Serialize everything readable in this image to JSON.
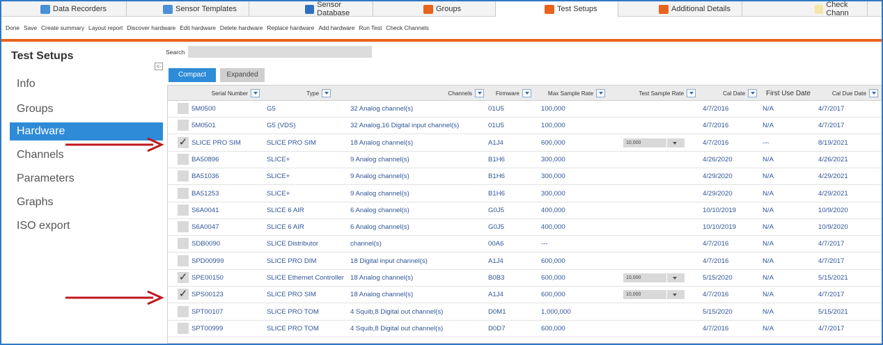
{
  "tabs": [
    {
      "label": "Data Recorders",
      "icon": "data-recorders-icon",
      "color": "#4a90d9"
    },
    {
      "label": "Sensor Templates",
      "icon": "sensor-templates-icon",
      "color": "#4a90d9"
    },
    {
      "label": "Sensor Database",
      "icon": "sensor-database-icon",
      "color": "#2e6fc0"
    },
    {
      "label": "Groups",
      "icon": "groups-icon",
      "color": "#e8641b"
    },
    {
      "label": "Test Setups",
      "icon": "test-setups-icon",
      "color": "#e8641b",
      "active": true
    },
    {
      "label": "Additional Details",
      "icon": "additional-details-icon",
      "color": "#e8641b"
    },
    {
      "label": "Check Chann",
      "icon": "check-channels-icon",
      "color": "#f5e6a6"
    }
  ],
  "toolbar": [
    "Done",
    "Save",
    "Create summary",
    "Layout report",
    "Discover hardware",
    "Edit hardware",
    "Delete hardware",
    "Replace hardware",
    "Add hardware",
    "Run Test",
    "Check Channels"
  ],
  "sidebar": {
    "title": "Test Setups",
    "collapse": "<-",
    "items": [
      "Info",
      "Groups",
      "Hardware",
      "Channels",
      "Parameters",
      "Graphs",
      "ISO export"
    ],
    "active": "Hardware"
  },
  "search": {
    "label": "Search",
    "value": ""
  },
  "view": {
    "compact": "Compact",
    "expanded": "Expanded"
  },
  "grid": {
    "columns": [
      "Serial Number",
      "Type",
      "Channels",
      "Firmware",
      "Max Sample Rate",
      "Test Sample Rate",
      "Cal Date",
      "First Use Date",
      "Cal Due Date"
    ],
    "rows": [
      {
        "checked": "",
        "serial": "5M0500",
        "type": "G5",
        "channels": "32 Analog channel(s)",
        "firmware": "01U5",
        "max_rate": "100,000",
        "test_rate": "",
        "cal_date": "4/7/2016",
        "first_use": "N/A",
        "cal_due": "4/7/2017"
      },
      {
        "checked": "",
        "serial": "5M0501",
        "type": "G5 (VDS)",
        "channels": "32 Analog,16 Digital input channel(s)",
        "firmware": "01U5",
        "max_rate": "100,000",
        "test_rate": "",
        "cal_date": "4/7/2016",
        "first_use": "N/A",
        "cal_due": "4/7/2017"
      },
      {
        "checked": "✓",
        "serial": "SLICE PRO SIM",
        "type": "SLICE PRO SIM",
        "channels": "18 Analog channel(s)",
        "firmware": "A1J4",
        "max_rate": "600,000",
        "test_rate": "10,000",
        "cal_date": "4/7/2016",
        "first_use": "---",
        "cal_due": "8/19/2021"
      },
      {
        "checked": "",
        "serial": "BA50896",
        "type": "SLICE+",
        "channels": "9 Analog channel(s)",
        "firmware": "B1H6",
        "max_rate": "300,000",
        "test_rate": "",
        "cal_date": "4/26/2020",
        "first_use": "N/A",
        "cal_due": "4/26/2021"
      },
      {
        "checked": "",
        "serial": "BA51036",
        "type": "SLICE+",
        "channels": "9 Analog channel(s)",
        "firmware": "B1H6",
        "max_rate": "300,000",
        "test_rate": "",
        "cal_date": "4/29/2020",
        "first_use": "N/A",
        "cal_due": "4/29/2021"
      },
      {
        "checked": "",
        "serial": "BA51253",
        "type": "SLICE+",
        "channels": "9 Analog channel(s)",
        "firmware": "B1H6",
        "max_rate": "300,000",
        "test_rate": "",
        "cal_date": "4/29/2020",
        "first_use": "N/A",
        "cal_due": "4/29/2021"
      },
      {
        "checked": "",
        "serial": "S6A0041",
        "type": "SLICE 6 AIR",
        "channels": "6 Analog channel(s)",
        "firmware": "G0J5",
        "max_rate": "400,000",
        "test_rate": "",
        "cal_date": "10/10/2019",
        "first_use": "N/A",
        "cal_due": "10/9/2020"
      },
      {
        "checked": "",
        "serial": "S6A0047",
        "type": "SLICE 6 AIR",
        "channels": "6 Analog channel(s)",
        "firmware": "G0J5",
        "max_rate": "400,000",
        "test_rate": "",
        "cal_date": "10/10/2019",
        "first_use": "N/A",
        "cal_due": "10/9/2020"
      },
      {
        "checked": "",
        "serial": "SDB0090",
        "type": "SLICE Distributor",
        "channels": " channel(s)",
        "firmware": "00A6",
        "max_rate": "---",
        "test_rate": "",
        "cal_date": "4/7/2016",
        "first_use": "N/A",
        "cal_due": "4/7/2017"
      },
      {
        "checked": "",
        "serial": "SPD00999",
        "type": "SLICE PRO DIM",
        "channels": "18 Digital input channel(s)",
        "firmware": "A1J4",
        "max_rate": "600,000",
        "test_rate": "",
        "cal_date": "4/7/2016",
        "first_use": "N/A",
        "cal_due": "4/7/2017"
      },
      {
        "checked": "✓",
        "serial": "SPE00150",
        "type": "SLICE Ethernet Controller",
        "channels": "18 Analog channel(s)",
        "firmware": "B0B3",
        "max_rate": "600,000",
        "test_rate": "10,000",
        "cal_date": "5/15/2020",
        "first_use": "N/A",
        "cal_due": "5/15/2021"
      },
      {
        "checked": "✓",
        "serial": "SPS00123",
        "type": "SLICE PRO SIM",
        "channels": "18 Analog channel(s)",
        "firmware": "A1J4",
        "max_rate": "600,000",
        "test_rate": "10,000",
        "cal_date": "4/7/2016",
        "first_use": "N/A",
        "cal_due": "4/7/2017"
      },
      {
        "checked": "",
        "serial": "SPT00107",
        "type": "SLICE PRO TOM",
        "channels": "4 Squib,8 Digital out channel(s)",
        "firmware": "D0M1",
        "max_rate": "1,000,000",
        "test_rate": "",
        "cal_date": "5/15/2020",
        "first_use": "N/A",
        "cal_due": "5/15/2021"
      },
      {
        "checked": "",
        "serial": "SPT00999",
        "type": "SLICE PRO TOM",
        "channels": "4 Squib,8 Digital out channel(s)",
        "firmware": "D0D7",
        "max_rate": "600,000",
        "test_rate": "",
        "cal_date": "4/7/2016",
        "first_use": "N/A",
        "cal_due": "4/7/2017"
      }
    ]
  },
  "annotation_color": "#c0171e"
}
